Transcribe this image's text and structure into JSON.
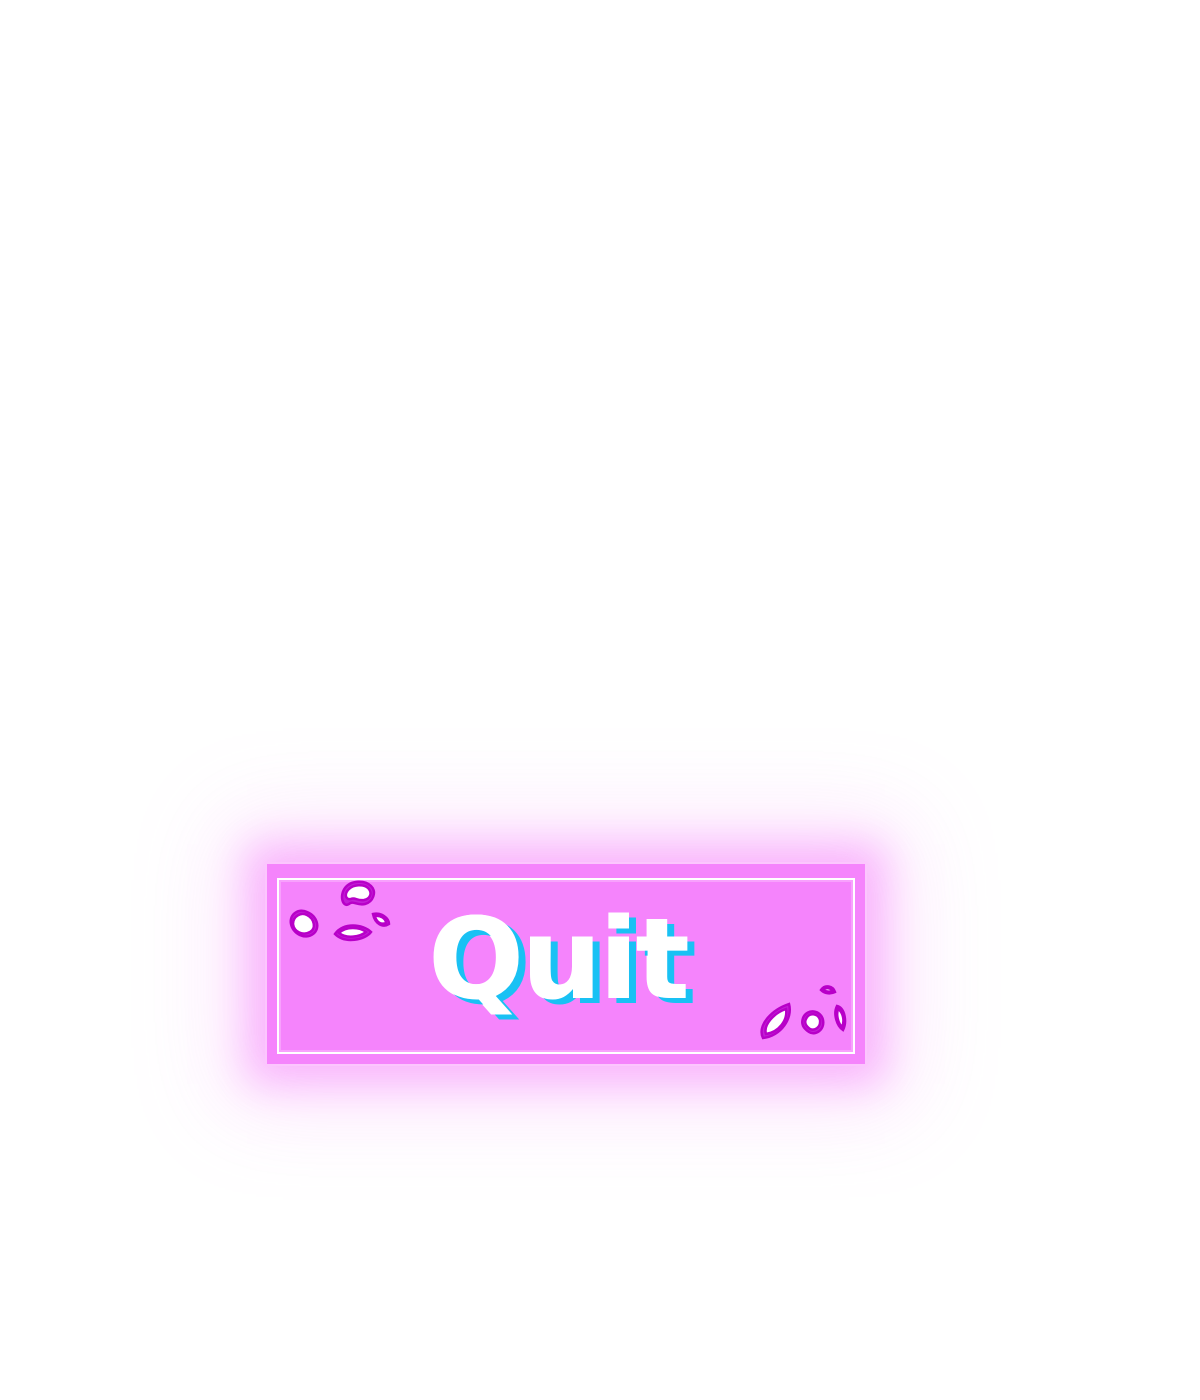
{
  "menu": {
    "quit_label": "Quit"
  },
  "colors": {
    "button_fill": "#f584fc",
    "button_glow": "#f584fc",
    "frame": "#ffffff",
    "label_text": "#ffffff",
    "label_shadow": "#19c1f4",
    "petal_outline": "#b800c8",
    "petal_fill": "#ffffff"
  },
  "decorations": {
    "top_left": "petals-icon",
    "bottom_right": "petals-icon"
  }
}
